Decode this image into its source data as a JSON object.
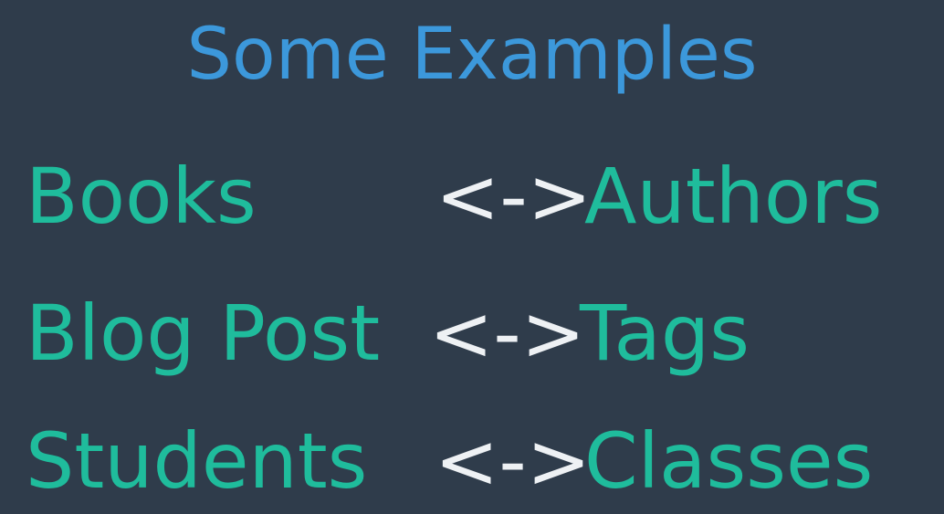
{
  "slide": {
    "title": "Some Examples",
    "rows": [
      {
        "left": "Books",
        "connector": "<->",
        "right": "Authors"
      },
      {
        "left": "Blog Post",
        "connector": "<->",
        "right": "Tags"
      },
      {
        "left": "Students",
        "connector": "<->",
        "right": "Classes"
      }
    ]
  },
  "colors": {
    "background": "#2f3c4b",
    "title": "#3c98db",
    "term": "#1fbc9c",
    "connector": "#eef1f4"
  }
}
